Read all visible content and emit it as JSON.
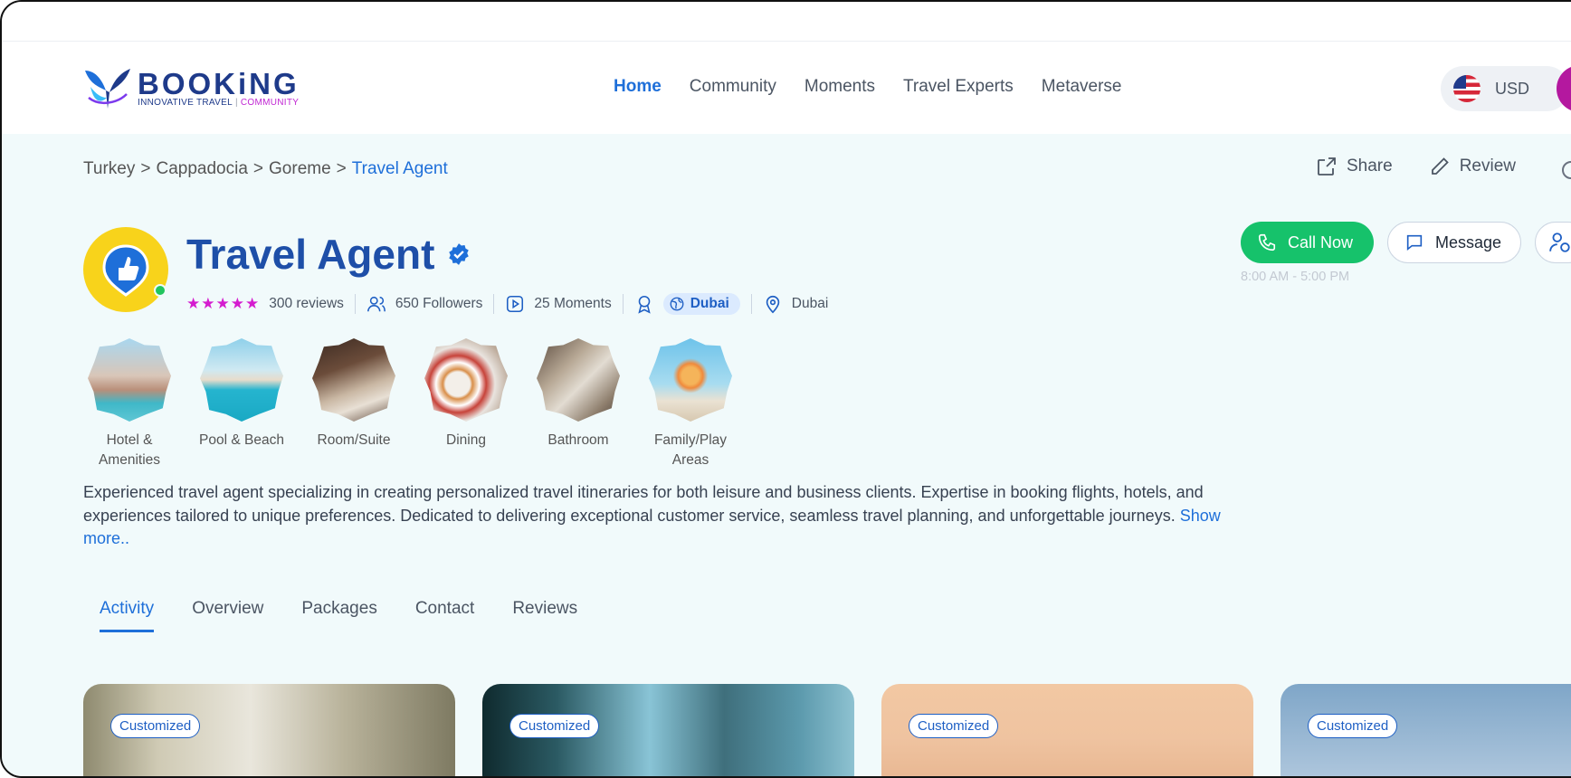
{
  "brand": {
    "name": "BOOKiNG",
    "tagline_left": "INNOVATIVE TRAVEL",
    "tagline_sep": "|",
    "tagline_right": "COMMUNITY"
  },
  "nav": [
    {
      "label": "Home",
      "active": true
    },
    {
      "label": "Community"
    },
    {
      "label": "Moments"
    },
    {
      "label": "Travel Experts"
    },
    {
      "label": "Metaverse"
    }
  ],
  "currency": {
    "label": "USD",
    "flag_icon": "us-flag-icon"
  },
  "breadcrumb": {
    "items": [
      "Turkey",
      "Cappadocia",
      "Goreme"
    ],
    "current": "Travel Agent",
    "separator": ">"
  },
  "top_actions": {
    "share": "Share",
    "review": "Review"
  },
  "profile": {
    "title": "Travel Agent",
    "rating_stars": "★★★★★",
    "reviews": "300 reviews",
    "followers": "650 Followers",
    "moments": "25 Moments",
    "badge_location": "Dubai",
    "location": "Dubai",
    "hours": "8:00 AM - 5:00 PM"
  },
  "buttons": {
    "call": "Call Now",
    "message": "Message"
  },
  "categories": [
    {
      "label": "Hotel & Amenities"
    },
    {
      "label": "Pool & Beach"
    },
    {
      "label": "Room/Suite"
    },
    {
      "label": "Dining"
    },
    {
      "label": "Bathroom"
    },
    {
      "label": "Family/Play Areas"
    }
  ],
  "description": {
    "text": "Experienced travel agent specializing in creating personalized travel itineraries for both leisure and business clients. Expertise in booking flights, hotels, and experiences tailored to unique preferences. Dedicated to delivering exceptional customer service, seamless travel planning, and unforgettable journeys.",
    "more": "Show more.."
  },
  "tabs": [
    {
      "label": "Activity",
      "active": true
    },
    {
      "label": "Overview"
    },
    {
      "label": "Packages"
    },
    {
      "label": "Contact"
    },
    {
      "label": "Reviews"
    }
  ],
  "cards": [
    {
      "badge": "Customized"
    },
    {
      "badge": "Customized"
    },
    {
      "badge": "Customized"
    },
    {
      "badge": "Customized"
    }
  ],
  "colors": {
    "accent": "#1e6fd9",
    "call_green": "#16c26b",
    "star_pink": "#d41ccf",
    "page_bg": "#f1fafb"
  }
}
